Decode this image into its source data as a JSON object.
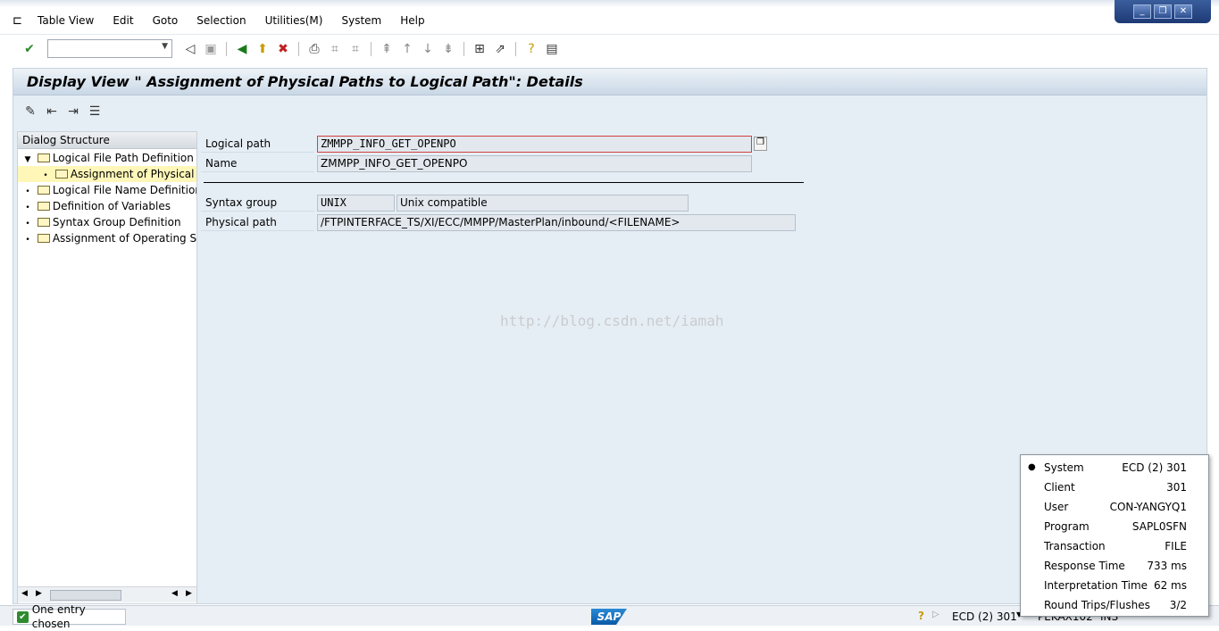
{
  "menu": [
    "Table View",
    "Edit",
    "Goto",
    "Selection",
    "Utilities(M)",
    "System",
    "Help"
  ],
  "window_controls": [
    "minimize",
    "restore",
    "close"
  ],
  "command_field": {
    "value": ""
  },
  "title": "Display View \" Assignment of Physical Paths to Logical Path\": Details",
  "dialog_structure": {
    "header": "Dialog Structure",
    "items": [
      {
        "label": "Logical File Path Definition",
        "level": 0,
        "expanded": true
      },
      {
        "label": "Assignment of Physical Pa",
        "level": 1,
        "selected": true
      },
      {
        "label": "Logical File Name Definition, C",
        "level": 0
      },
      {
        "label": "Definition of Variables",
        "level": 0
      },
      {
        "label": "Syntax Group Definition",
        "level": 0
      },
      {
        "label": "Assignment of Operating Sys",
        "level": 0
      }
    ]
  },
  "form": {
    "logical_path_label": "Logical path",
    "logical_path": "ZMMPP_INFO_GET_OPENPO",
    "name_label": "Name",
    "name": "ZMMPP_INFO_GET_OPENPO",
    "syntax_group_label": "Syntax group",
    "syntax_group": "UNIX",
    "syntax_group_text": "Unix compatible",
    "physical_path_label": "Physical path",
    "physical_path": "/FTPINTERFACE_TS/XI/ECC/MMPP/MasterPlan/inbound/<FILENAME>"
  },
  "watermark": "http://blog.csdn.net/iamah",
  "status": {
    "message": "One entry chosen",
    "system": "ECD (2) 301",
    "server": "PEKAX102",
    "mode": "INS",
    "logo": "SAP"
  },
  "system_popup": [
    {
      "key": "System",
      "value": "ECD (2) 301",
      "active": true
    },
    {
      "key": "Client",
      "value": "301"
    },
    {
      "key": "User",
      "value": "CON-YANGYQ1"
    },
    {
      "key": "Program",
      "value": "SAPL0SFN"
    },
    {
      "key": "Transaction",
      "value": "FILE"
    },
    {
      "key": "Response Time",
      "value": "733 ms"
    },
    {
      "key": "Interpretation Time",
      "value": "62 ms"
    },
    {
      "key": "Round Trips/Flushes",
      "value": "3/2"
    }
  ]
}
